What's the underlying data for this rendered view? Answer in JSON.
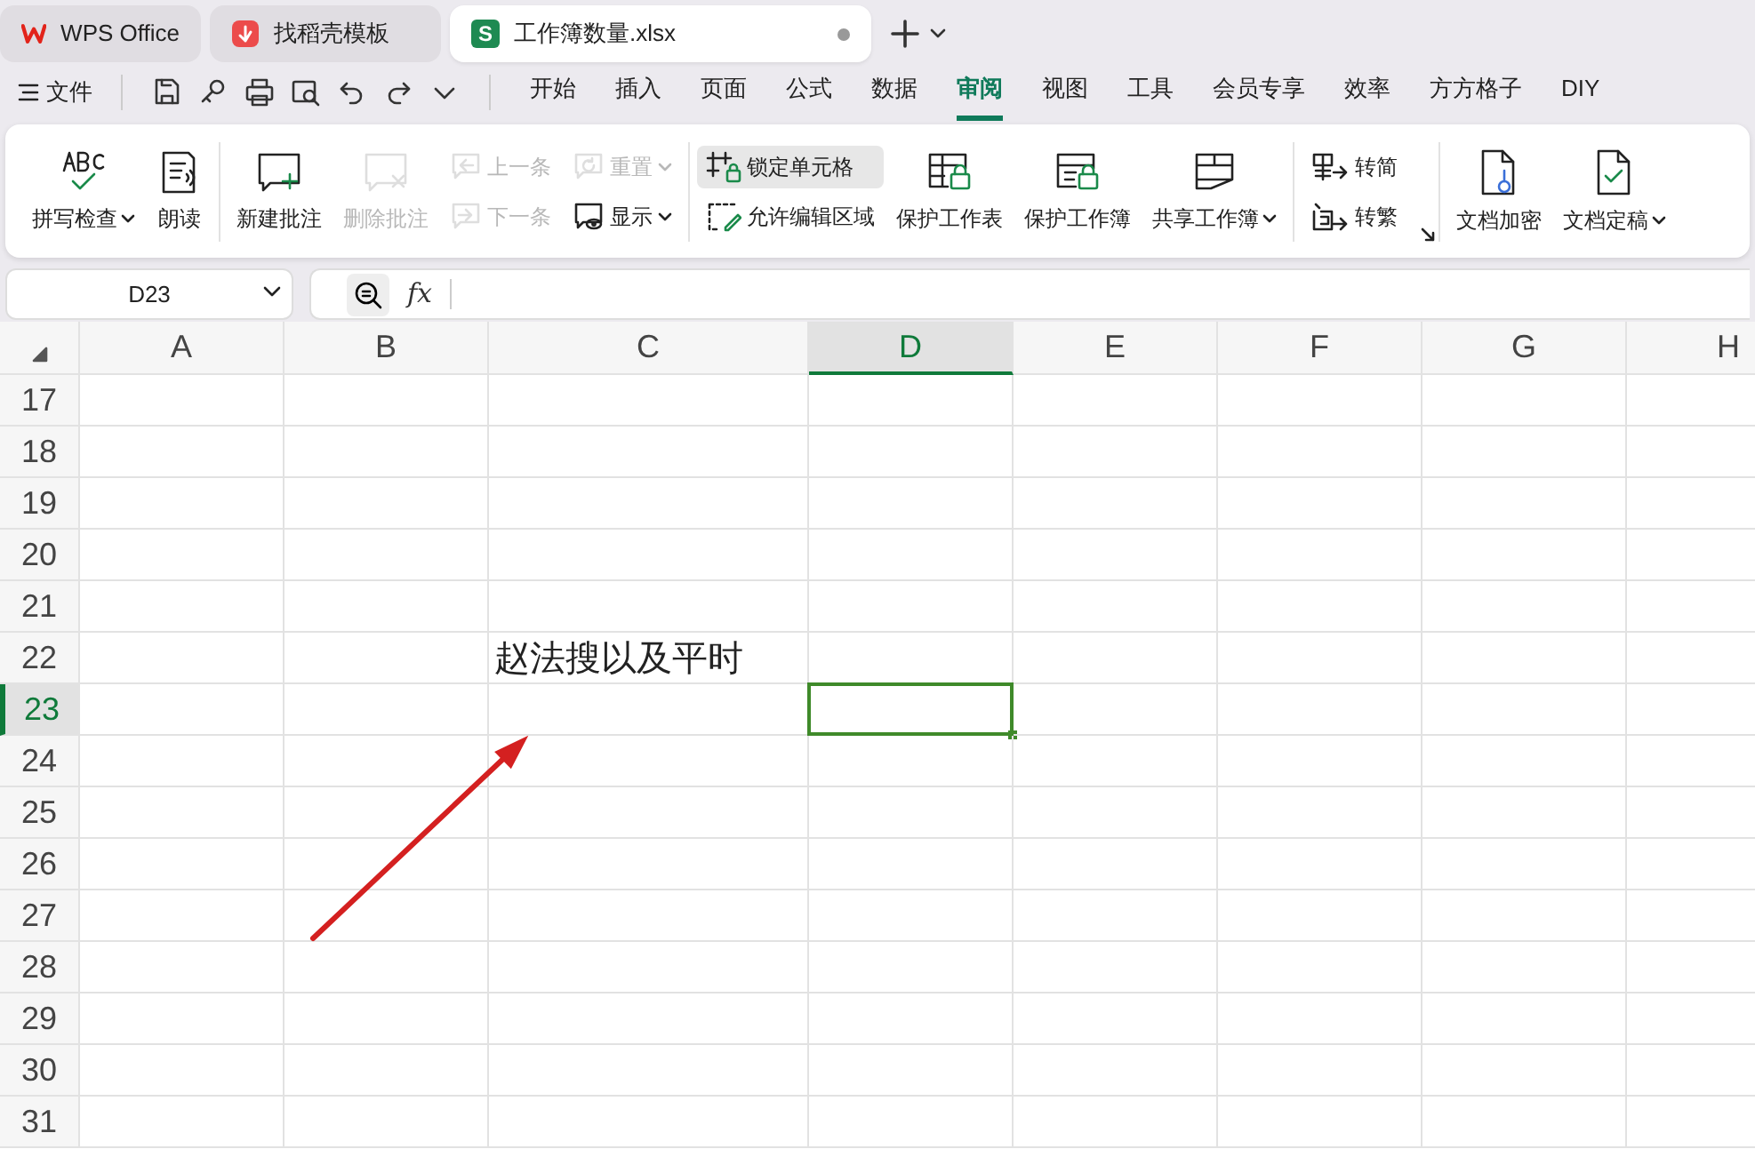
{
  "app_tabs": [
    {
      "label": "WPS Office",
      "kind": "home",
      "selected": false,
      "unsaved": false
    },
    {
      "label": "找稻壳模板",
      "kind": "templates",
      "selected": false,
      "unsaved": false
    },
    {
      "label": "工作簿数量.xlsx",
      "kind": "sheet",
      "badge": "S",
      "selected": true,
      "unsaved": true
    }
  ],
  "menu": {
    "file_label": "文件",
    "ribbon_tabs": [
      {
        "label": "开始",
        "selected": false
      },
      {
        "label": "插入",
        "selected": false
      },
      {
        "label": "页面",
        "selected": false
      },
      {
        "label": "公式",
        "selected": false
      },
      {
        "label": "数据",
        "selected": false
      },
      {
        "label": "审阅",
        "selected": true
      },
      {
        "label": "视图",
        "selected": false
      },
      {
        "label": "工具",
        "selected": false
      },
      {
        "label": "会员专享",
        "selected": false
      },
      {
        "label": "效率",
        "selected": false
      },
      {
        "label": "方方格子",
        "selected": false
      },
      {
        "label": "DIY",
        "selected": false
      }
    ]
  },
  "ribbon": {
    "groups": [
      {
        "items": [
          {
            "kind": "large",
            "label": "拼写检查",
            "disabled": false,
            "dropdown": true,
            "pressed": false
          },
          {
            "kind": "large",
            "label": "朗读",
            "disabled": false,
            "dropdown": false,
            "pressed": false
          }
        ]
      },
      {
        "items": [
          {
            "kind": "large",
            "label": "新建批注",
            "disabled": false,
            "dropdown": false,
            "pressed": false
          },
          {
            "kind": "large",
            "label": "删除批注",
            "disabled": true,
            "dropdown": false,
            "pressed": false
          },
          {
            "kind": "stack",
            "buttons": [
              {
                "label": "上一条",
                "disabled": true,
                "dropdown": false,
                "pressed": false
              },
              {
                "label": "下一条",
                "disabled": true,
                "dropdown": false,
                "pressed": false
              }
            ]
          },
          {
            "kind": "stack",
            "buttons": [
              {
                "label": "重置",
                "disabled": true,
                "dropdown": true,
                "pressed": false
              },
              {
                "label": "显示",
                "disabled": false,
                "dropdown": true,
                "pressed": false
              }
            ]
          }
        ]
      },
      {
        "items": [
          {
            "kind": "stack",
            "buttons": [
              {
                "label": "锁定单元格",
                "disabled": false,
                "dropdown": false,
                "pressed": true
              },
              {
                "label": "允许编辑区域",
                "disabled": false,
                "dropdown": false,
                "pressed": false
              }
            ]
          },
          {
            "kind": "large",
            "label": "保护工作表",
            "disabled": false,
            "dropdown": false,
            "pressed": false
          },
          {
            "kind": "large",
            "label": "保护工作簿",
            "disabled": false,
            "dropdown": false,
            "pressed": false
          },
          {
            "kind": "large",
            "label": "共享工作簿",
            "disabled": false,
            "dropdown": true,
            "pressed": false
          }
        ]
      },
      {
        "launcher": true,
        "items": [
          {
            "kind": "stack",
            "buttons": [
              {
                "label": "转简",
                "disabled": false,
                "dropdown": false,
                "pressed": false
              },
              {
                "label": "转繁",
                "disabled": false,
                "dropdown": false,
                "pressed": false
              }
            ]
          }
        ]
      },
      {
        "items": [
          {
            "kind": "large",
            "label": "文档加密",
            "disabled": false,
            "dropdown": false,
            "pressed": false
          },
          {
            "kind": "large",
            "label": "文档定稿",
            "disabled": false,
            "dropdown": true,
            "pressed": false
          }
        ]
      }
    ]
  },
  "formula_bar": {
    "name_box": "D23",
    "function_label": "fx"
  },
  "sheet": {
    "columns": [
      {
        "label": "A",
        "selected": false
      },
      {
        "label": "B",
        "selected": false
      },
      {
        "label": "C",
        "selected": false
      },
      {
        "label": "D",
        "selected": true
      },
      {
        "label": "E",
        "selected": false
      },
      {
        "label": "F",
        "selected": false
      },
      {
        "label": "G",
        "selected": false
      },
      {
        "label": "H",
        "selected": false
      }
    ],
    "rows": [
      {
        "label": "17",
        "selected": false
      },
      {
        "label": "18",
        "selected": false
      },
      {
        "label": "19",
        "selected": false
      },
      {
        "label": "20",
        "selected": false
      },
      {
        "label": "21",
        "selected": false
      },
      {
        "label": "22",
        "selected": false,
        "cells": [
          {
            "kind": "empty"
          },
          {
            "kind": "empty"
          },
          {
            "kind": "text",
            "text": "赵法搜以及平时"
          }
        ]
      },
      {
        "label": "23",
        "selected": true,
        "cells": [
          {
            "kind": "empty"
          },
          {
            "kind": "empty"
          },
          {
            "kind": "empty"
          },
          {
            "kind": "active"
          }
        ]
      },
      {
        "label": "24",
        "selected": false
      },
      {
        "label": "25",
        "selected": false
      },
      {
        "label": "26",
        "selected": false
      },
      {
        "label": "27",
        "selected": false
      },
      {
        "label": "28",
        "selected": false
      },
      {
        "label": "29",
        "selected": false
      },
      {
        "label": "30",
        "selected": false
      },
      {
        "label": "31",
        "selected": false
      }
    ]
  }
}
